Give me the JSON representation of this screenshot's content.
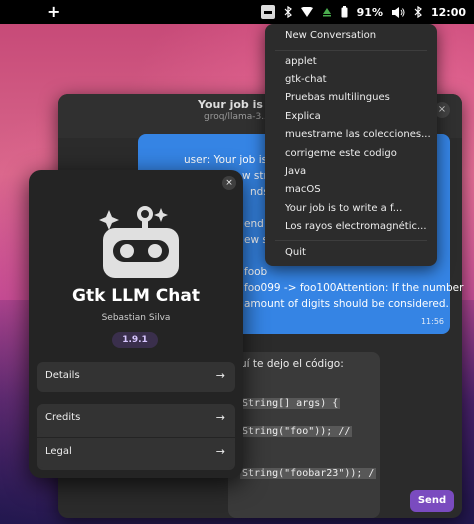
{
  "topbar": {
    "add_label": "+",
    "battery_label": "91%",
    "clock": "12:00"
  },
  "chat": {
    "title": "Your job is to",
    "subtitle": "groq/llama-3.3-",
    "close_label": "×",
    "user_lines": [
      "user: Your job is t",
      "w stri",
      "nds w",
      "",
      "end w",
      "ew st",
      "",
      "foob",
      "foo099 -> foo100Attention: If the number",
      "amount of digits should be considered."
    ],
    "user_time": "11:56",
    "bot_intro": "uí te dejo el código:",
    "code_lines": [
      "String[] args) {",
      "String(\"foo\")); //",
      "String(\"foobar23\")); /"
    ],
    "send_label": "Send"
  },
  "about": {
    "close_label": "×",
    "app_name": "Gtk LLM Chat",
    "author": "Sebastian Silva",
    "version": "1.9.1",
    "rows": [
      {
        "label": "Details",
        "arrow": "→"
      },
      {
        "label": "Credits",
        "arrow": "→"
      },
      {
        "label": "Legal",
        "arrow": "→"
      }
    ]
  },
  "menu": {
    "items": [
      "New Conversation",
      "applet",
      "gtk-chat",
      "Pruebas multilingues",
      "Explica",
      "muestrame las colecciones...",
      "corrigeme este codigo",
      "Java",
      "macOS",
      "Your job is to write a f...",
      "Los rayos electromagnétic...",
      "Quit"
    ]
  },
  "colors": {
    "accent_blue": "#3584e4",
    "send_purple": "#7a4bbf"
  }
}
